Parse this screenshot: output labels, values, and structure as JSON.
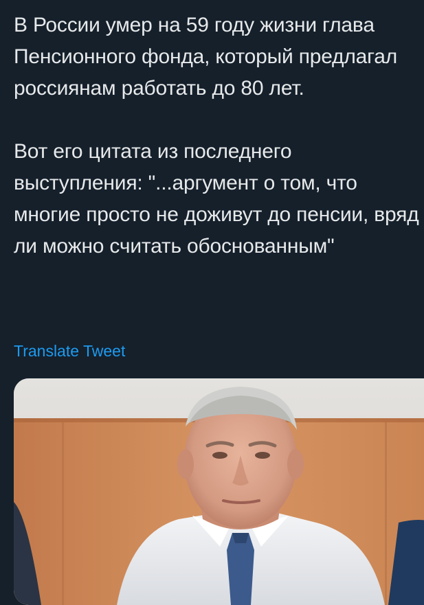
{
  "tweet": {
    "paragraphs": [
      "В России умер на 59 году жизни глава Пенсионного фонда, который предлагал россиянам работать до 80 лет.",
      "Вот его цитата из последнего выступления: \"...аргумент о том, что многие просто не доживут до пенсии, вряд ли можно считать обоснованным\""
    ],
    "translate_label": "Translate Tweet"
  },
  "colors": {
    "background": "#15202b",
    "text": "#e7e9ea",
    "link": "#1d9bf0"
  }
}
